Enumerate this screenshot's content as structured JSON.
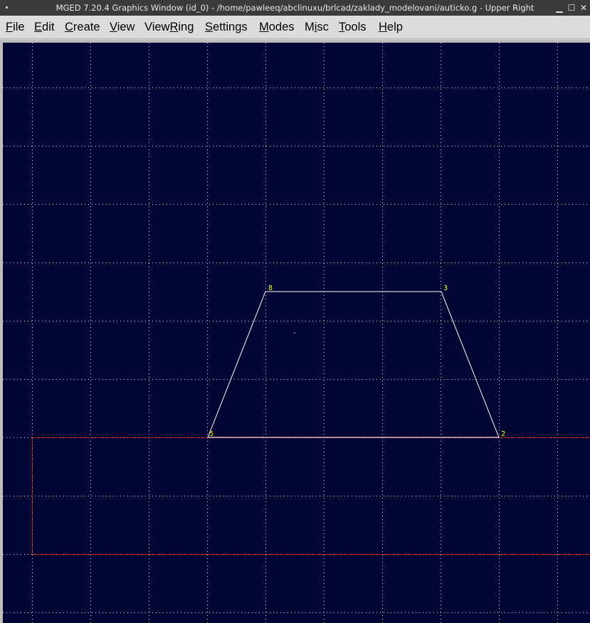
{
  "window": {
    "title": "MGED 7.20.4 Graphics Window (id_0) - /home/pawleeq/abclinuxu/brlcad/zaklady_modelovani/auticko.g - Upper Right",
    "minimize_glyph": "▁",
    "maximize_glyph": "☐",
    "close_glyph": "✕"
  },
  "menubar": {
    "items": [
      {
        "pre": "",
        "ul": "F",
        "post": "ile"
      },
      {
        "pre": "",
        "ul": "E",
        "post": "dit"
      },
      {
        "pre": "",
        "ul": "C",
        "post": "reate"
      },
      {
        "pre": "",
        "ul": "V",
        "post": "iew"
      },
      {
        "pre": "View",
        "ul": "R",
        "post": "ing"
      },
      {
        "pre": "",
        "ul": "S",
        "post": "ettings"
      },
      {
        "pre": "",
        "ul": "M",
        "post": "odes"
      },
      {
        "pre": "M",
        "ul": "i",
        "post": "sc"
      },
      {
        "pre": "",
        "ul": "T",
        "post": "ools"
      },
      {
        "pre": "",
        "ul": "H",
        "post": "elp"
      }
    ]
  },
  "graphics": {
    "background_color": "#000533",
    "grid_color": "#d8d8d8",
    "shape_color": "#ffffff",
    "box_color": "#ff2a00",
    "label_color": "#ffff00",
    "vertex_labels": [
      "8",
      "3",
      "5",
      "2"
    ]
  }
}
